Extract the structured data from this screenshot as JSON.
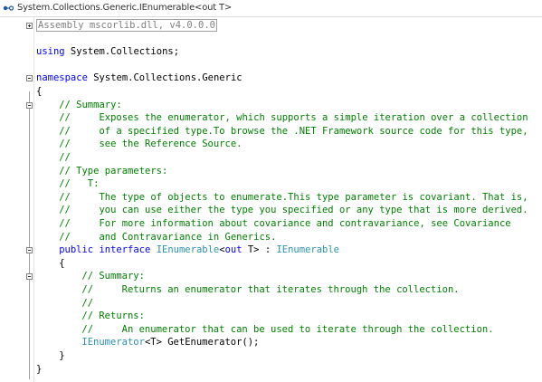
{
  "tab": {
    "title": "System.Collections.Generic.IEnumerable<out T>",
    "icon": "interface-icon"
  },
  "editor": {
    "lines": [
      {
        "tokens": [
          {
            "t": "Assembly mscorlib.dll, v4.0.0.0",
            "c": "asm"
          }
        ],
        "fold": "plus",
        "indent": 0
      },
      {
        "tokens": [],
        "indent": 0
      },
      {
        "tokens": [
          {
            "t": "using",
            "c": "kw"
          },
          {
            "t": " System.Collections;",
            "c": "tx"
          }
        ],
        "indent": 0
      },
      {
        "tokens": [],
        "indent": 0
      },
      {
        "tokens": [
          {
            "t": "namespace",
            "c": "kw"
          },
          {
            "t": " System.Collections.Generic",
            "c": "tx"
          }
        ],
        "fold": "minus",
        "indent": 0
      },
      {
        "tokens": [
          {
            "t": "{",
            "c": "tx"
          }
        ],
        "indent": 0
      },
      {
        "tokens": [
          {
            "t": "// Summary:",
            "c": "cm"
          }
        ],
        "fold": "minus",
        "indent": 4
      },
      {
        "tokens": [
          {
            "t": "//     Exposes the enumerator, which supports a simple iteration over a collection",
            "c": "cm"
          }
        ],
        "indent": 4
      },
      {
        "tokens": [
          {
            "t": "//     of a specified type.To browse the .NET Framework source code for this type,",
            "c": "cm"
          }
        ],
        "indent": 4
      },
      {
        "tokens": [
          {
            "t": "//     see the Reference Source.",
            "c": "cm"
          }
        ],
        "indent": 4
      },
      {
        "tokens": [
          {
            "t": "//",
            "c": "cm"
          }
        ],
        "indent": 4
      },
      {
        "tokens": [
          {
            "t": "// Type parameters:",
            "c": "cm"
          }
        ],
        "indent": 4
      },
      {
        "tokens": [
          {
            "t": "//   T:",
            "c": "cm"
          }
        ],
        "indent": 4
      },
      {
        "tokens": [
          {
            "t": "//     The type of objects to enumerate.This type parameter is covariant. That is,",
            "c": "cm"
          }
        ],
        "indent": 4
      },
      {
        "tokens": [
          {
            "t": "//     you can use either the type you specified or any type that is more derived.",
            "c": "cm"
          }
        ],
        "indent": 4
      },
      {
        "tokens": [
          {
            "t": "//     For more information about covariance and contravariance, see Covariance",
            "c": "cm"
          }
        ],
        "indent": 4
      },
      {
        "tokens": [
          {
            "t": "//     and Contravariance in Generics.",
            "c": "cm"
          }
        ],
        "indent": 4
      },
      {
        "tokens": [
          {
            "t": "public",
            "c": "kw"
          },
          {
            "t": " ",
            "c": "tx"
          },
          {
            "t": "interface",
            "c": "kw"
          },
          {
            "t": " ",
            "c": "tx"
          },
          {
            "t": "IEnumerable",
            "c": "ty"
          },
          {
            "t": "<",
            "c": "tx"
          },
          {
            "t": "out",
            "c": "kw"
          },
          {
            "t": " T> : ",
            "c": "tx"
          },
          {
            "t": "IEnumerable",
            "c": "ty"
          }
        ],
        "fold": "minus",
        "indent": 4
      },
      {
        "tokens": [
          {
            "t": "{",
            "c": "tx"
          }
        ],
        "indent": 4
      },
      {
        "tokens": [
          {
            "t": "// Summary:",
            "c": "cm"
          }
        ],
        "fold": "minus",
        "indent": 8
      },
      {
        "tokens": [
          {
            "t": "//     Returns an enumerator that iterates through the collection.",
            "c": "cm"
          }
        ],
        "indent": 8
      },
      {
        "tokens": [
          {
            "t": "//",
            "c": "cm"
          }
        ],
        "indent": 8
      },
      {
        "tokens": [
          {
            "t": "// Returns:",
            "c": "cm"
          }
        ],
        "indent": 8
      },
      {
        "tokens": [
          {
            "t": "//     An enumerator that can be used to iterate through the collection.",
            "c": "cm"
          }
        ],
        "indent": 8
      },
      {
        "tokens": [
          {
            "t": "IEnumerator",
            "c": "ty"
          },
          {
            "t": "<T> GetEnumerator();",
            "c": "tx"
          }
        ],
        "indent": 8
      },
      {
        "tokens": [
          {
            "t": "}",
            "c": "tx"
          }
        ],
        "indent": 4
      },
      {
        "tokens": [
          {
            "t": "}",
            "c": "tx"
          }
        ],
        "indent": 0
      }
    ]
  }
}
